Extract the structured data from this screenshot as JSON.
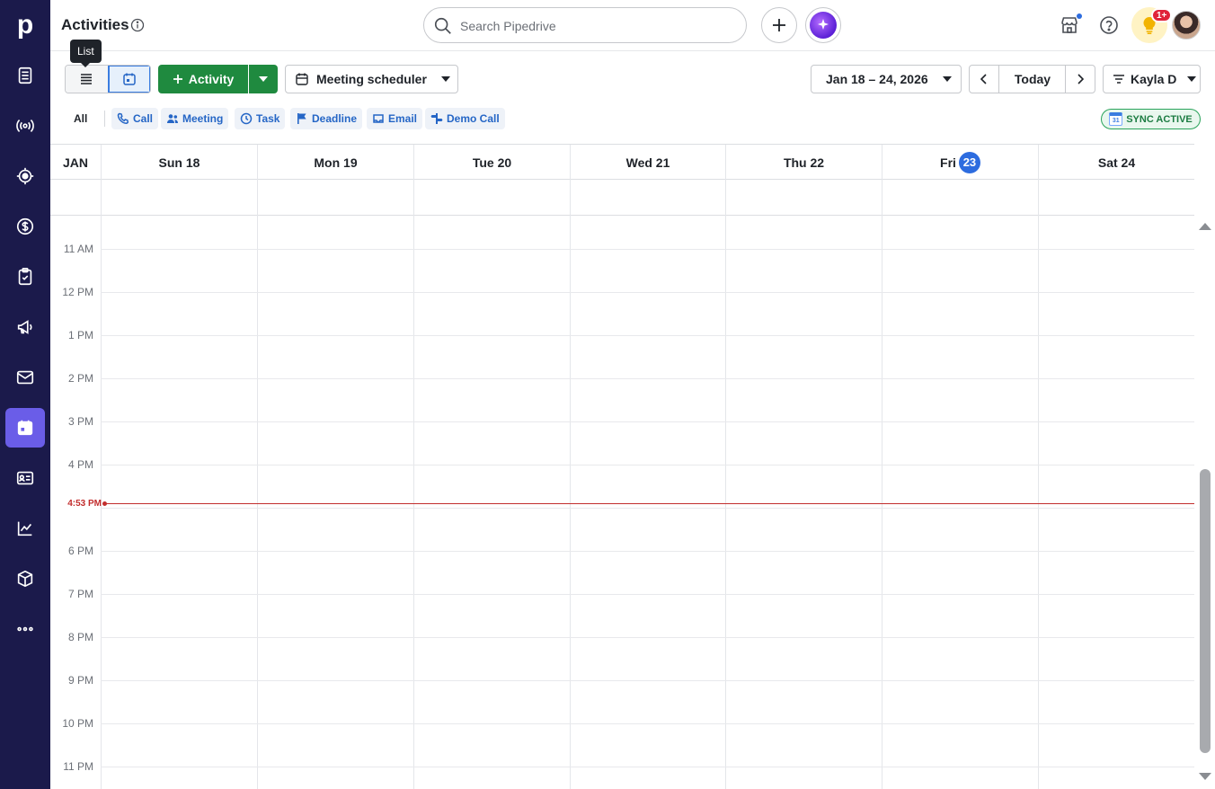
{
  "app": {
    "logo": "p"
  },
  "sidebar": {
    "items": [
      {
        "name": "leads",
        "icon": "inbox-icon"
      },
      {
        "name": "campaigns",
        "icon": "broadcast-icon"
      },
      {
        "name": "projects",
        "icon": "target-icon"
      },
      {
        "name": "deals",
        "icon": "dollar-icon"
      },
      {
        "name": "tasks",
        "icon": "clipboard-check-icon"
      },
      {
        "name": "marketing",
        "icon": "megaphone-icon"
      },
      {
        "name": "mail",
        "icon": "mail-icon"
      },
      {
        "name": "activities",
        "icon": "calendar-icon",
        "active": true
      },
      {
        "name": "contacts",
        "icon": "id-card-icon"
      },
      {
        "name": "insights",
        "icon": "chart-icon"
      },
      {
        "name": "products",
        "icon": "box-icon"
      },
      {
        "name": "more",
        "icon": "more-icon"
      }
    ]
  },
  "header": {
    "title": "Activities",
    "search_placeholder": "Search Pipedrive",
    "notification_badge": "1+",
    "tooltip": "List"
  },
  "toolbar": {
    "add_activity_label": "Activity",
    "meeting_scheduler_label": "Meeting scheduler",
    "date_range": "Jan 18 – 24, 2026",
    "today_label": "Today",
    "user_filter": "Kayla D"
  },
  "filters": {
    "all_label": "All",
    "types": [
      {
        "label": "Call",
        "icon": "phone-icon"
      },
      {
        "label": "Meeting",
        "icon": "people-icon"
      },
      {
        "label": "Task",
        "icon": "clock-icon"
      },
      {
        "label": "Deadline",
        "icon": "flag-icon"
      },
      {
        "label": "Email",
        "icon": "email-icon"
      },
      {
        "label": "Demo Call",
        "icon": "demo-icon"
      }
    ],
    "sync_label": "SYNC ACTIVE",
    "sync_cal_number": "31"
  },
  "calendar": {
    "month": "JAN",
    "days": [
      {
        "label": "Sun 18"
      },
      {
        "label": "Mon 19"
      },
      {
        "label": "Tue 20"
      },
      {
        "label": "Wed 21"
      },
      {
        "label": "Thu 22"
      },
      {
        "label": "Fri",
        "today_number": "23",
        "is_today": true
      },
      {
        "label": "Sat 24"
      }
    ],
    "hours": [
      "11 AM",
      "12 PM",
      "1 PM",
      "2 PM",
      "3 PM",
      "4 PM",
      "",
      "6 PM",
      "7 PM",
      "8 PM",
      "9 PM",
      "10 PM",
      "11 PM"
    ],
    "current_time": "4:53 PM"
  },
  "colors": {
    "sidebar_bg": "#1b1a4b",
    "sidebar_active": "#6a5de8",
    "primary_green": "#1f8a3f",
    "link_blue": "#2566c6",
    "now_red": "#c22d2d"
  }
}
